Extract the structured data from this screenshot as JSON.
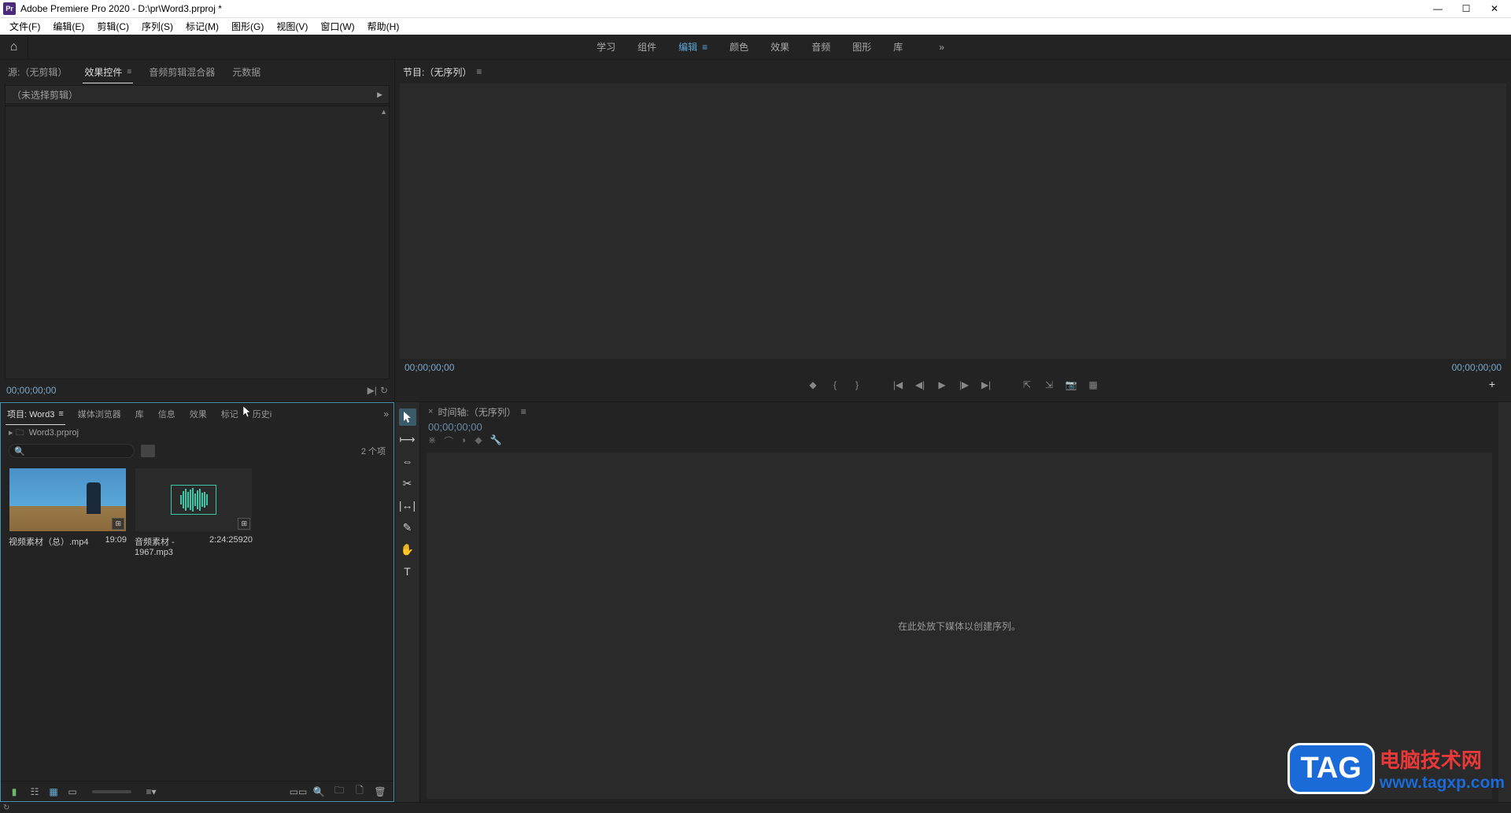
{
  "titlebar": {
    "app_icon_text": "Pr",
    "title": "Adobe Premiere Pro 2020 - D:\\pr\\Word3.prproj *"
  },
  "menubar": {
    "items": [
      "文件(F)",
      "编辑(E)",
      "剪辑(C)",
      "序列(S)",
      "标记(M)",
      "图形(G)",
      "视图(V)",
      "窗口(W)",
      "帮助(H)"
    ]
  },
  "workspace": {
    "items": [
      "学习",
      "组件",
      "编辑",
      "颜色",
      "效果",
      "音频",
      "图形",
      "库"
    ],
    "active_index": 2,
    "more": "»"
  },
  "source_panel": {
    "tabs": [
      "源:（无剪辑）",
      "效果控件",
      "音频剪辑混合器",
      "元数据"
    ],
    "active_index": 1,
    "clip_selector": "（未选择剪辑）",
    "timecode": "00;00;00;00"
  },
  "program_panel": {
    "title": "节目:（无序列）",
    "tc_left": "00;00;00;00",
    "tc_right": "00;00;00;00"
  },
  "project_panel": {
    "tabs": [
      "项目: Word3",
      "媒体浏览器",
      "库",
      "信息",
      "效果",
      "标记",
      "历史i"
    ],
    "active_index": 0,
    "more": "»",
    "breadcrumb": "Word3.prproj",
    "item_count": "2 个项",
    "items": [
      {
        "name": "视频素材（总）.mp4",
        "duration": "19:09",
        "thumb_type": "video"
      },
      {
        "name": "音频素材 - 1967.mp3",
        "duration": "2:24:25920",
        "thumb_type": "audio"
      }
    ]
  },
  "timeline_panel": {
    "title": "时间轴:（无序列）",
    "timecode": "00;00;00;00",
    "placeholder": "在此处放下媒体以创建序列。"
  },
  "watermark": {
    "tag": "TAG",
    "line1": "电脑技术网",
    "line2": "www.tagxp.com"
  }
}
